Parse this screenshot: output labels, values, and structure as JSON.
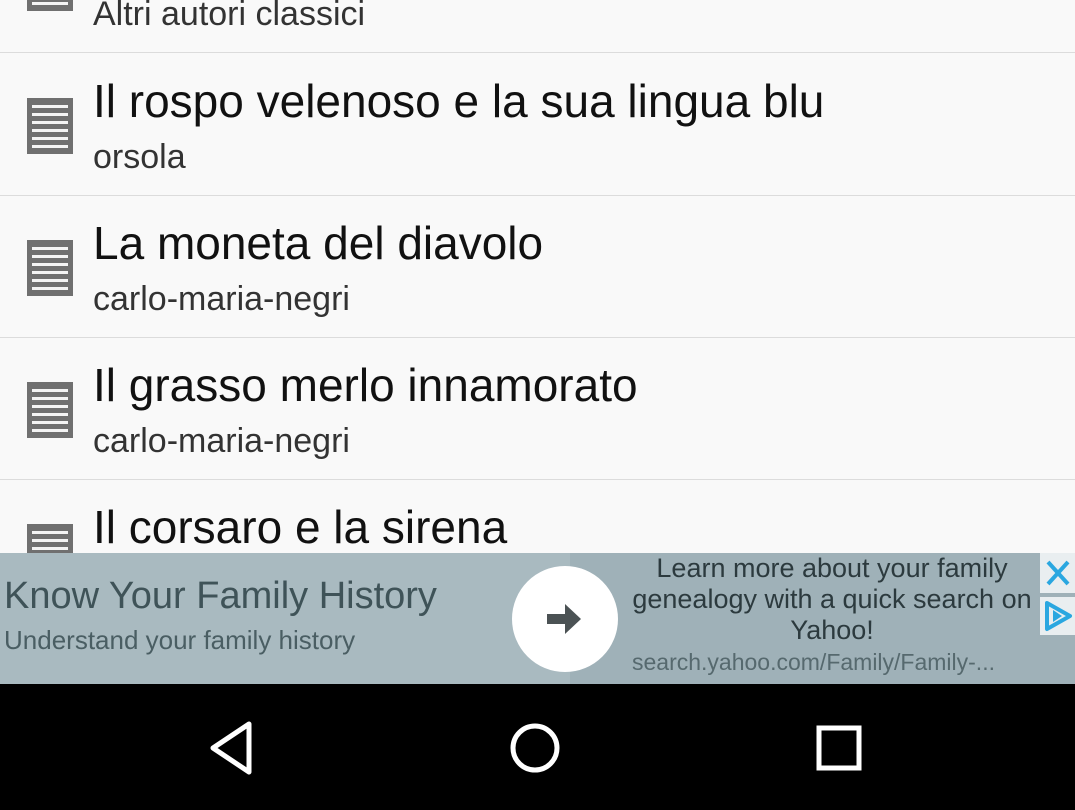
{
  "list": {
    "items": [
      {
        "title": "",
        "author": "Altri autori classici"
      },
      {
        "title": "Il rospo velenoso e la sua lingua blu",
        "author": "orsola"
      },
      {
        "title": "La moneta del diavolo",
        "author": "carlo-maria-negri"
      },
      {
        "title": "Il grasso merlo innamorato",
        "author": "carlo-maria-negri"
      },
      {
        "title": "Il corsaro e la sirena",
        "author": ""
      }
    ],
    "icon": "document-lines-icon"
  },
  "ad": {
    "headline": "Know Your Family History",
    "subline": "Understand your family history",
    "description": "Learn more about your family genealogy with a quick search on Yahoo!",
    "url": "search.yahoo.com/Family/Family-...",
    "colors": {
      "background": "#9fb1b8",
      "close": "#2aa7e0",
      "choices": "#2aa7e0"
    }
  },
  "navbar": {
    "icons": [
      "back-triangle-icon",
      "home-circle-icon",
      "recents-square-icon"
    ]
  }
}
